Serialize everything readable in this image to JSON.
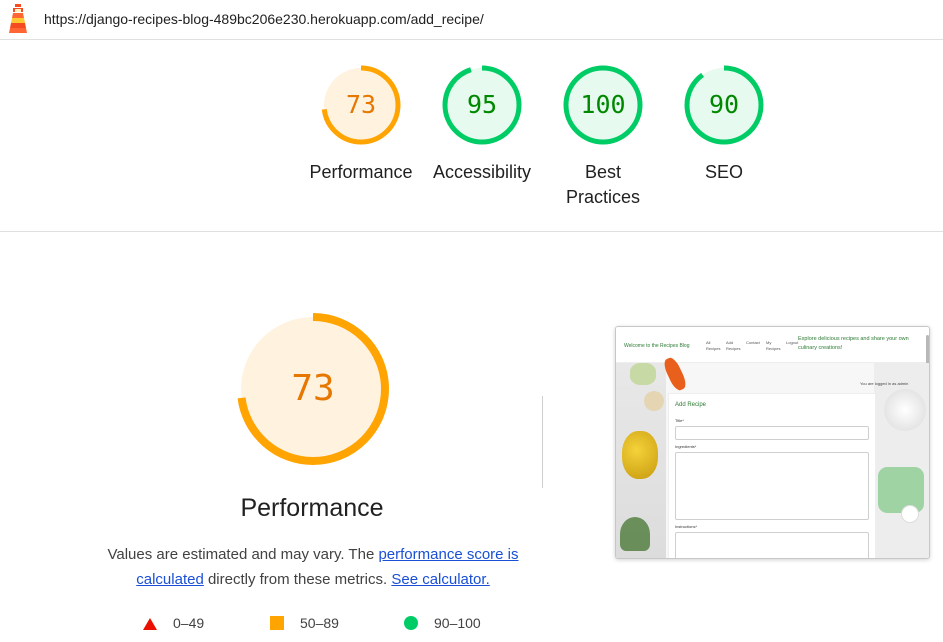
{
  "header": {
    "url": "https://django-recipes-blog-489bc206e230.herokuapp.com/add_recipe/"
  },
  "colors": {
    "pass": "#00cc66",
    "pass_text": "#008800",
    "pass_bg": "#e6faef",
    "average": "#ffa400",
    "average_text": "#e67700",
    "average_bg": "#fff3e0",
    "fail": "#eb0f00"
  },
  "gauges": [
    {
      "score": 73,
      "label": "Performance",
      "rating": "average"
    },
    {
      "score": 95,
      "label": "Accessibility",
      "rating": "pass"
    },
    {
      "score": 100,
      "label": "Best Practices",
      "rating": "pass"
    },
    {
      "score": 90,
      "label": "SEO",
      "rating": "pass"
    }
  ],
  "performance": {
    "score": 73,
    "title": "Performance",
    "desc_prefix": "Values are estimated and may vary. The ",
    "desc_link1": "performance score is calculated",
    "desc_middle": " directly from these metrics. ",
    "desc_link2": "See calculator."
  },
  "legend": [
    {
      "shape": "triangle",
      "range": "0–49"
    },
    {
      "shape": "square",
      "range": "50–89"
    },
    {
      "shape": "circle",
      "range": "90–100"
    }
  ],
  "screenshot": {
    "brand": "Welcome to the Recipes Blog",
    "nav": [
      "All Recipes",
      "Add Recipes",
      "Contact",
      "My Recipes",
      "Logout"
    ],
    "tagline": "Explore delicious recipes and share your own culinary creations!",
    "logged_in": "You are logged in as admin",
    "form_title": "Add Recipe",
    "field_title": "Title*",
    "field_ingredients": "Ingredients*",
    "field_instructions": "Instructions*"
  }
}
